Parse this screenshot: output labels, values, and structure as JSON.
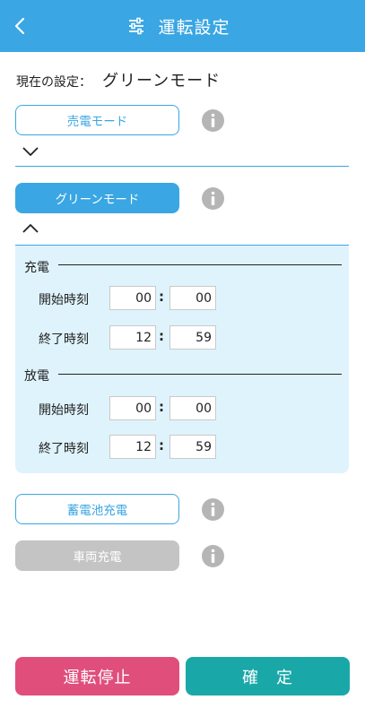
{
  "header": {
    "title": "運転設定"
  },
  "current": {
    "label": "現在の設定：",
    "value": "グリーンモード"
  },
  "modes": {
    "sell": "売電モード",
    "green": "グリーンモード",
    "battery": "蓄電池充電",
    "vehicle": "車両充電"
  },
  "green_panel": {
    "charge": {
      "title": "充電",
      "start_label": "開始時刻",
      "start_hour": "00",
      "start_min": "00",
      "end_label": "終了時刻",
      "end_hour": "12",
      "end_min": "59"
    },
    "discharge": {
      "title": "放電",
      "start_label": "開始時刻",
      "start_hour": "00",
      "start_min": "00",
      "end_label": "終了時刻",
      "end_hour": "12",
      "end_min": "59"
    },
    "colon": ":"
  },
  "footer": {
    "stop_label": "運転停止",
    "confirm_label": "確　定"
  },
  "colors": {
    "primary": "#3aa6e3",
    "stop": "#e04f7b",
    "confirm": "#1aa7a8",
    "panel": "#dff3fc",
    "disabled": "#c4c4c4"
  },
  "icons": {
    "back": "chevron-left-icon",
    "settings": "sliders-icon",
    "info": "info-icon",
    "expand": "chevron-down-icon",
    "collapse": "chevron-up-icon"
  }
}
